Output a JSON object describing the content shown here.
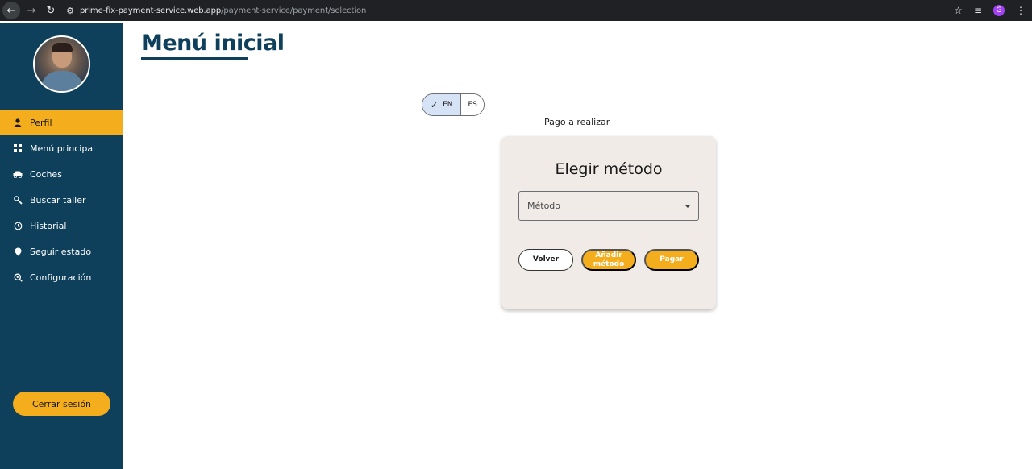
{
  "browser": {
    "url_host": "prime-fix-payment-service.web.app",
    "url_path": "/payment-service/payment/selection",
    "profile_initial": "G"
  },
  "sidebar": {
    "items": [
      {
        "label": "Perfil",
        "icon": "person-icon"
      },
      {
        "label": "Menú principal",
        "icon": "grid-icon"
      },
      {
        "label": "Coches",
        "icon": "car-icon"
      },
      {
        "label": "Buscar taller",
        "icon": "wrench-icon"
      },
      {
        "label": "Historial",
        "icon": "history-icon"
      },
      {
        "label": "Seguir estado",
        "icon": "location-icon"
      },
      {
        "label": "Configuración",
        "icon": "settings-icon"
      }
    ],
    "active_index": 0,
    "logout_label": "Cerrar sesión"
  },
  "main": {
    "title": "Menú inicial",
    "lang": {
      "en": "EN",
      "es": "ES",
      "selected": "EN"
    },
    "subtitle": "Pago a realizar",
    "card": {
      "title": "Elegir método",
      "select_placeholder": "Método",
      "buttons": {
        "back": "Volver",
        "add_method": "Añadir método",
        "pay": "Pagar"
      }
    }
  },
  "colors": {
    "sidebar_bg": "#0e3f5b",
    "accent": "#f4ad1d",
    "card_bg": "#f0ebe6"
  }
}
